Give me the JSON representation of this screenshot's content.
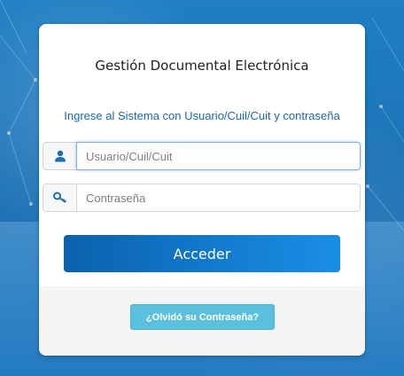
{
  "login": {
    "title": "Gestión Documental Electrónica",
    "subtitle": "Ingrese al Sistema con Usuario/Cuil/Cuit y contraseña",
    "username_placeholder": "Usuario/Cuil/Cuit",
    "password_placeholder": "Contraseña",
    "submit_label": "Acceder",
    "forgot_label": "¿Olvidó su Contraseña?"
  },
  "icons": {
    "username": "user-icon",
    "password": "key-icon"
  },
  "colors": {
    "primary_button": "#0a62ad",
    "forgot_button": "#5bc0de",
    "subtitle_text": "#1a6aa8"
  }
}
